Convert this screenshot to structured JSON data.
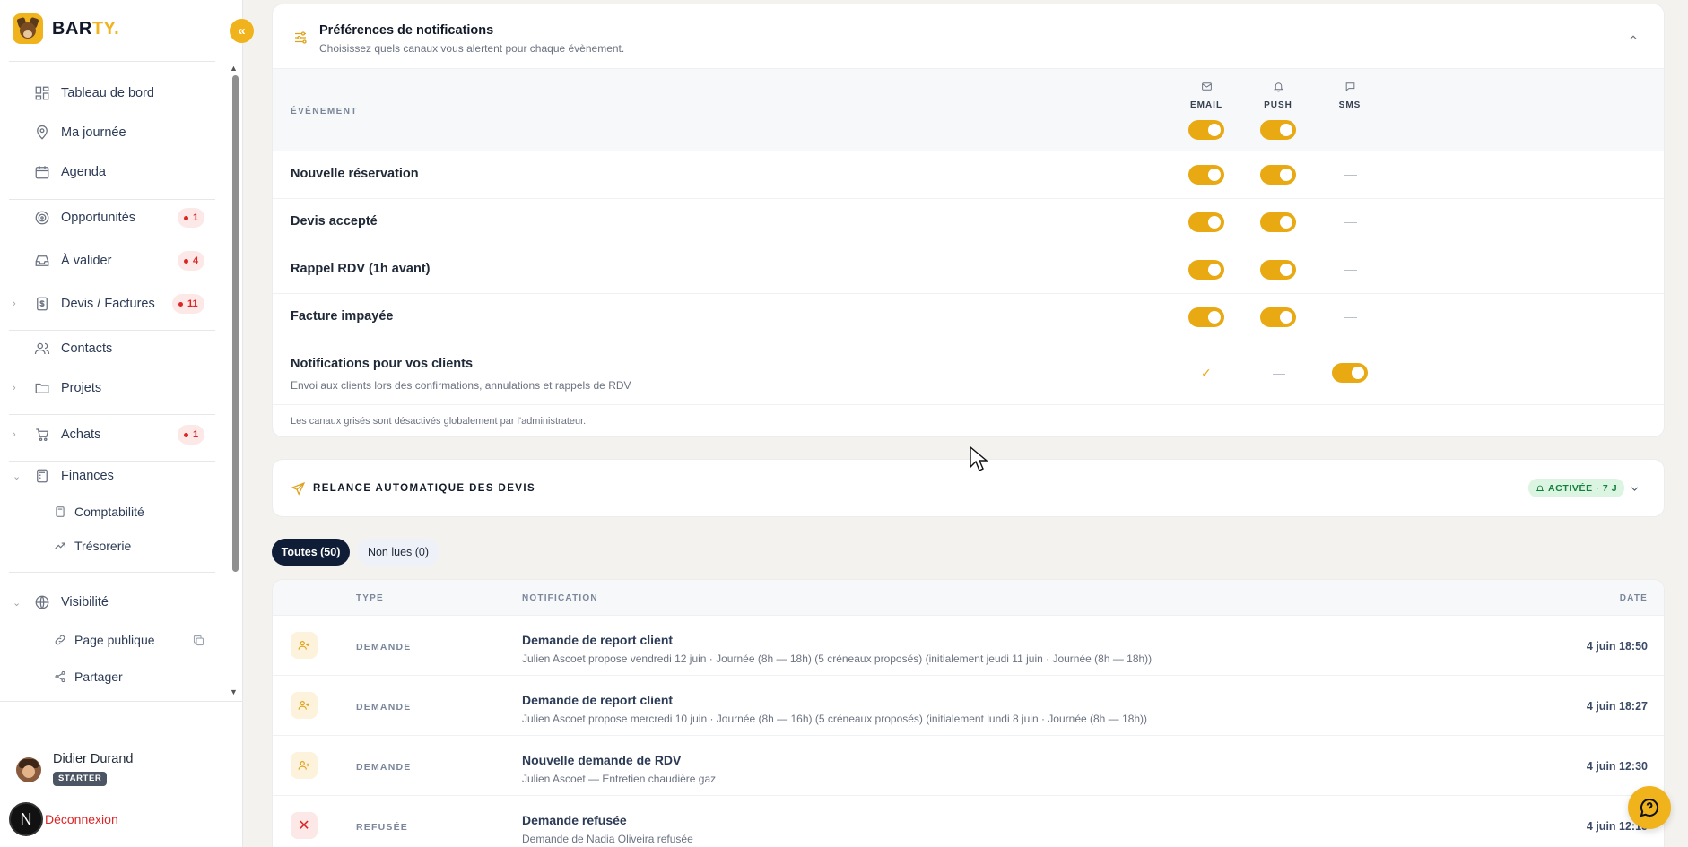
{
  "brand": {
    "name_main": "BAR",
    "name_accent": "TY."
  },
  "sidebar": {
    "collapse_label": "«",
    "items": [
      {
        "label": "Tableau de bord",
        "icon": "dashboard-icon"
      },
      {
        "label": "Ma journée",
        "icon": "map-pin-icon"
      },
      {
        "label": "Agenda",
        "icon": "calendar-icon"
      },
      {
        "label": "Opportunités",
        "icon": "target-icon",
        "badge": "1"
      },
      {
        "label": "À valider",
        "icon": "inbox-icon",
        "badge": "4"
      },
      {
        "label": "Devis / Factures",
        "icon": "dollar-file-icon",
        "badge": "11",
        "expandable": true
      },
      {
        "label": "Contacts",
        "icon": "users-icon"
      },
      {
        "label": "Projets",
        "icon": "folder-icon",
        "expandable": true
      },
      {
        "label": "Achats",
        "icon": "cart-icon",
        "badge": "1",
        "expandable": true
      },
      {
        "label": "Finances",
        "icon": "calculator-icon",
        "expanded": true
      },
      {
        "label": "Comptabilité",
        "icon": "calculator-icon",
        "sub": true
      },
      {
        "label": "Trésorerie",
        "icon": "trend-icon",
        "sub": true
      },
      {
        "label": "Visibilité",
        "icon": "globe-icon",
        "expanded": true
      },
      {
        "label": "Page publique",
        "icon": "link-icon",
        "sub": true
      },
      {
        "label": "Partager",
        "icon": "share-icon",
        "sub": true
      }
    ]
  },
  "user": {
    "name": "Didier Durand",
    "plan": "STARTER",
    "logout_label": "Déconnexion",
    "n_badge": "N"
  },
  "prefs": {
    "title": "Préférences de notifications",
    "subtitle": "Choisissez quels canaux vous alertent pour chaque évènement.",
    "event_header": "ÉVÈNEMENT",
    "channels": [
      {
        "label": "EMAIL",
        "icon": "mail-icon",
        "master_on": true
      },
      {
        "label": "PUSH",
        "icon": "bell-icon",
        "master_on": true
      },
      {
        "label": "SMS",
        "icon": "message-icon",
        "master_on": false
      }
    ],
    "events": [
      {
        "label": "Nouvelle réservation",
        "email": "on",
        "push": "on",
        "sms": "none"
      },
      {
        "label": "Devis accepté",
        "email": "on",
        "push": "on",
        "sms": "none"
      },
      {
        "label": "Rappel RDV (1h avant)",
        "email": "on",
        "push": "on",
        "sms": "none"
      },
      {
        "label": "Facture impayée",
        "email": "on",
        "push": "on",
        "sms": "none"
      }
    ],
    "client_notifications": {
      "label": "Notifications pour vos clients",
      "description": "Envoi aux clients lors des confirmations, annulations et rappels de RDV",
      "email": "check",
      "push": "none",
      "sms": "on"
    },
    "footnote": "Les canaux grisés sont désactivés globalement par l'administrateur."
  },
  "relance": {
    "title": "RELANCE AUTOMATIQUE DES DEVIS",
    "status": "ACTIVÉE · 7 J"
  },
  "filters": {
    "all": "Toutes (50)",
    "unread": "Non lues (0)"
  },
  "notifications": {
    "headers": {
      "type": "TYPE",
      "notification": "NOTIFICATION",
      "date": "DATE"
    },
    "rows": [
      {
        "type": "DEMANDE",
        "icon": "user-plus-icon",
        "title": "Demande de report client",
        "description": "Julien Ascoet propose vendredi 12 juin · Journée (8h — 18h) (5 créneaux proposés) (initialement jeudi 11 juin · Journée (8h — 18h))",
        "date": "4 juin 18:50"
      },
      {
        "type": "DEMANDE",
        "icon": "user-plus-icon",
        "title": "Demande de report client",
        "description": "Julien Ascoet propose mercredi 10 juin · Journée (8h — 16h) (5 créneaux proposés) (initialement lundi 8 juin · Journée (8h — 18h))",
        "date": "4 juin 18:27"
      },
      {
        "type": "DEMANDE",
        "icon": "user-plus-icon",
        "title": "Nouvelle demande de RDV",
        "description": "Julien Ascoet — Entretien chaudière gaz",
        "date": "4 juin 12:30"
      },
      {
        "type": "REFUSÉE",
        "icon": "close-icon",
        "title": "Demande refusée",
        "description": "Demande de Nadia Oliveira refusée",
        "date": "4 juin 12:15"
      }
    ]
  },
  "colors": {
    "accent": "#f1b31c",
    "toggle_on": "#e8a912",
    "danger": "#dc2626",
    "navy": "#0f1e36"
  }
}
